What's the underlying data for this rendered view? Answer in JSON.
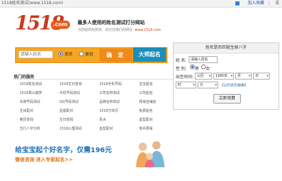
{
  "topbar": {
    "site_title": "1518姓名测试(www.1518.com)",
    "favorite": "加入收藏",
    "more": "设"
  },
  "logo": {
    "number": "1518",
    "suffix": ".com"
  },
  "header": {
    "tagline": "最多人使用的姓名测试打分网站",
    "subline": "为您提供免费测、请记住我们的网址:",
    "url": "www.1518.com"
  },
  "search": {
    "name_placeholder": "请输入姓名",
    "option_single": "单名",
    "option_double": "复姓",
    "confirm_label": "确 定",
    "master_label": "大师起名",
    "selected": "单名"
  },
  "services": {
    "title": "热门的服务",
    "rows": [
      [
        "1518姓名测试",
        "1518生日查询",
        "1518手机号码",
        "宝宝起名"
      ],
      [
        "1518周公解梦",
        "手机号码测试",
        "公司名称测试",
        "公司起名"
      ],
      [
        "车牌号码测试",
        "QQ号码测试",
        "品牌名称测试",
        "周易店铺名"
      ],
      [
        "生肖配对",
        "星座配对",
        "1518万年历",
        "免费起名"
      ],
      [
        "黄历查询",
        "生日密码",
        "风水",
        "血型配对"
      ],
      [
        "五行八字分析",
        "1518心理测试",
        "血型配对",
        "有问周易"
      ]
    ]
  },
  "banner": {
    "headline": "给宝宝起个好名字，仅需196元",
    "sub": "微信咨询 进入专家起名>>"
  },
  "panel": {
    "title": "姓名是否匹配生辰八字",
    "name_label": "姓 名:",
    "name_value": "请输入姓名",
    "gender_label": "性 别:",
    "gender_male": "男",
    "gender_female": "女",
    "gender_selected": "男",
    "birth_label": "出生时间:",
    "calendar": "公历",
    "year": "1980年",
    "month": "月",
    "day": "日",
    "hour": "时",
    "minute": "分",
    "lunar_link": "【公历农历转换】",
    "test_button": "立即测算"
  }
}
